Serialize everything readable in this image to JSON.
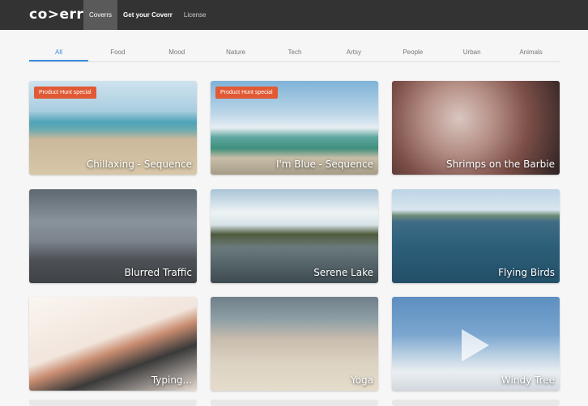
{
  "header": {
    "logo": "co>err",
    "nav": [
      {
        "label": "Coverrs",
        "active": true
      },
      {
        "label": "Get your Coverr",
        "bold": true
      },
      {
        "label": "License"
      }
    ]
  },
  "tabs": [
    "All",
    "Food",
    "Mood",
    "Nature",
    "Tech",
    "Artsy",
    "People",
    "Urban",
    "Animals"
  ],
  "active_tab": "All",
  "cards": [
    {
      "title": "Chillaxing - Sequence",
      "badge": "Product Hunt special"
    },
    {
      "title": "I'm Blue - Sequence",
      "badge": "Product Hunt special"
    },
    {
      "title": "Shrimps on the Barbie"
    },
    {
      "title": "Blurred Traffic"
    },
    {
      "title": "Serene Lake"
    },
    {
      "title": "Flying Birds"
    },
    {
      "title": "Typing..."
    },
    {
      "title": "Yoga"
    },
    {
      "title": "Windy Tree"
    }
  ]
}
